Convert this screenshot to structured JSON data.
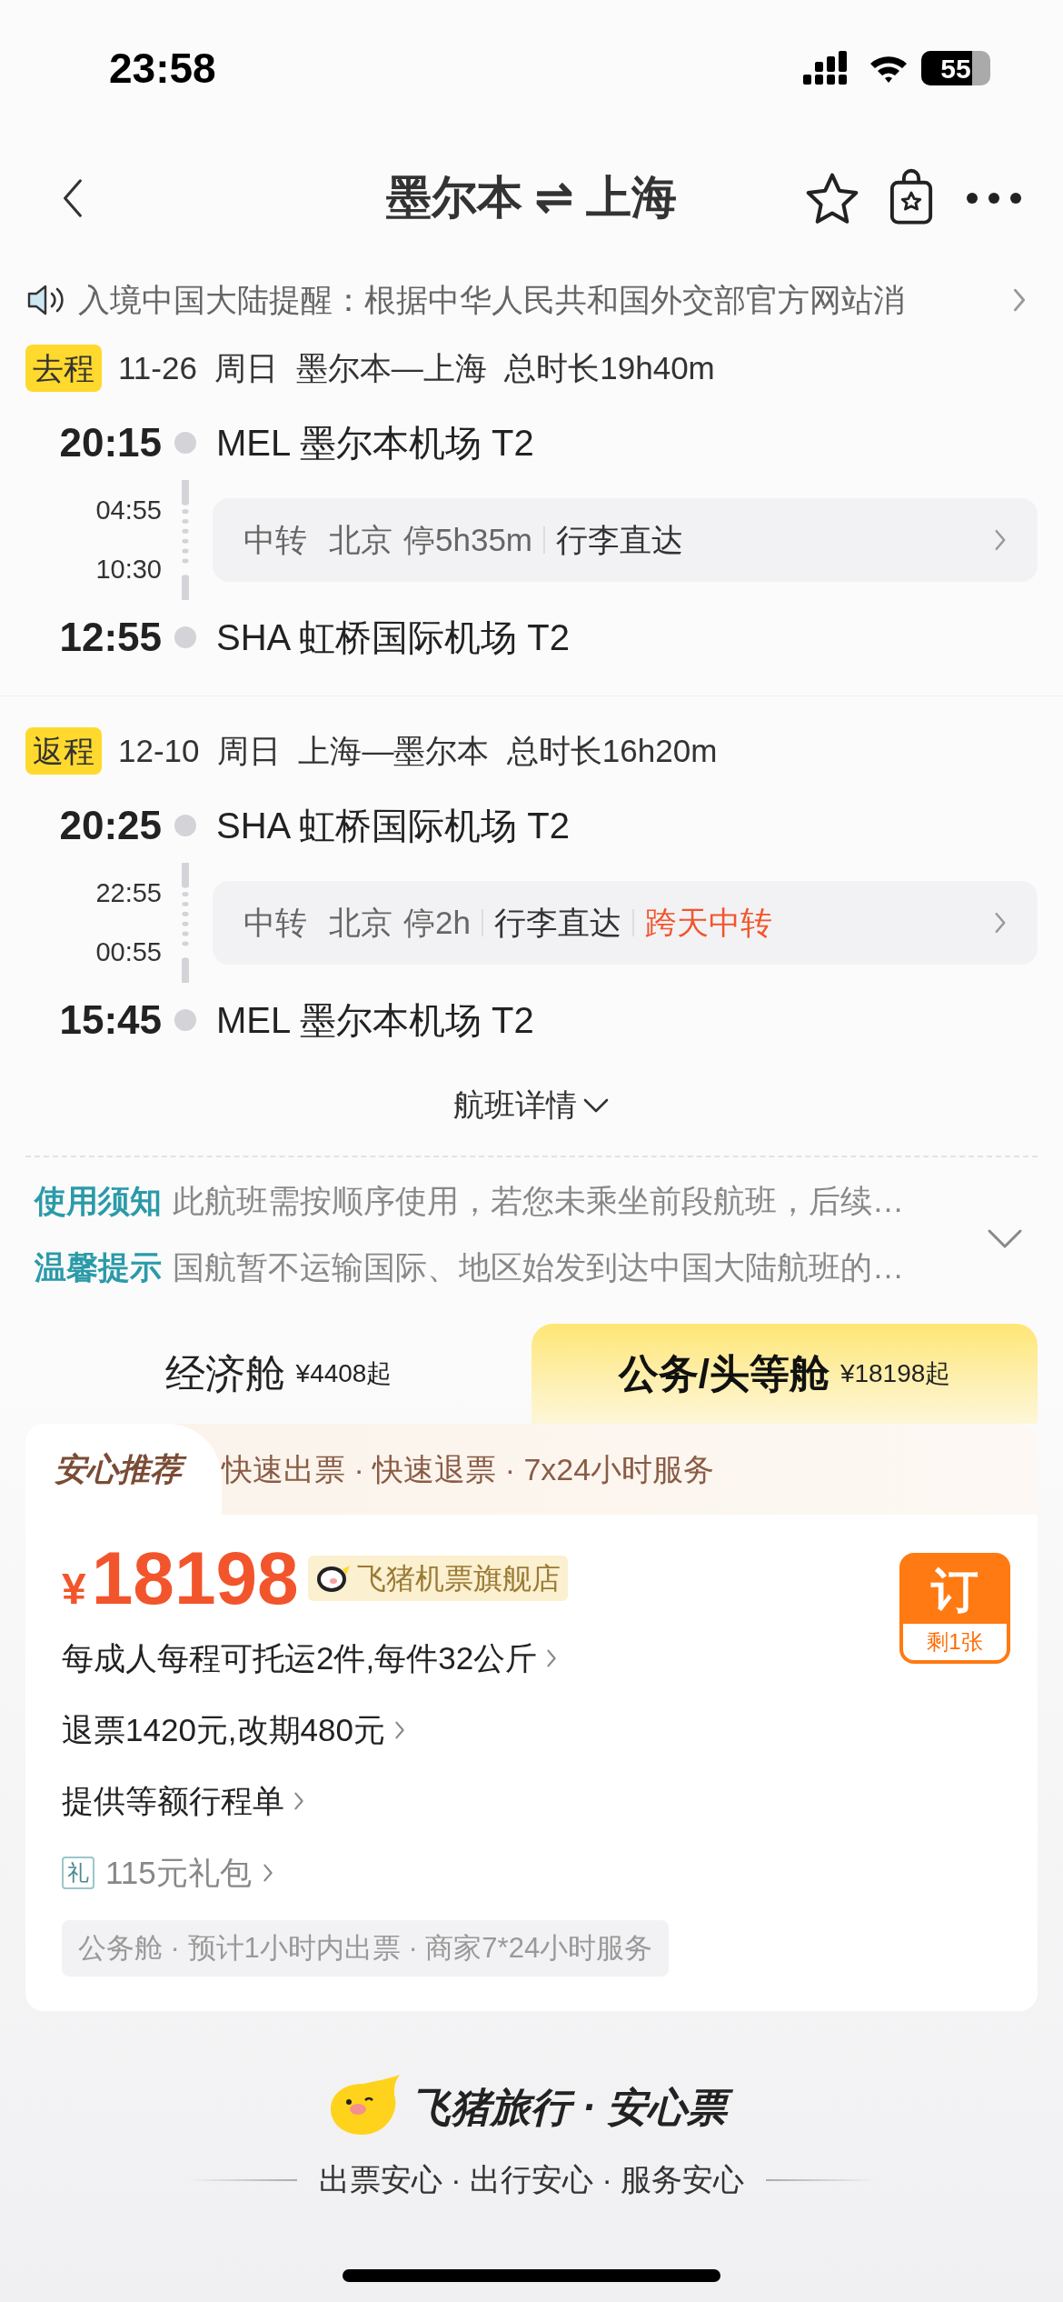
{
  "status_bar": {
    "time": "23:58",
    "battery": "55"
  },
  "nav": {
    "title": "墨尔本 ⇌ 上海"
  },
  "notice": {
    "text": "入境中国大陆提醒：根据中华人民共和国外交部官方网站消"
  },
  "legs": [
    {
      "tag": "去程",
      "date": "11-26",
      "weekday": "周日",
      "route": "墨尔本—上海",
      "duration": "总时长19h40m",
      "departure": {
        "time": "20:15",
        "airport": "MEL 墨尔本机场 T2"
      },
      "layover_times": [
        "04:55",
        "10:30"
      ],
      "transfer": {
        "label": "中转",
        "city": "北京",
        "stop": "停5h35m",
        "tags": [
          {
            "text": "行李直达",
            "kind": "normal"
          }
        ]
      },
      "arrival": {
        "time": "12:55",
        "airport": "SHA 虹桥国际机场 T2"
      }
    },
    {
      "tag": "返程",
      "date": "12-10",
      "weekday": "周日",
      "route": "上海—墨尔本",
      "duration": "总时长16h20m",
      "departure": {
        "time": "20:25",
        "airport": "SHA 虹桥国际机场 T2"
      },
      "layover_times": [
        "22:55",
        "00:55"
      ],
      "transfer": {
        "label": "中转",
        "city": "北京",
        "stop": "停2h",
        "tags": [
          {
            "text": "行李直达",
            "kind": "normal"
          },
          {
            "text": "跨天中转",
            "kind": "alert"
          }
        ]
      },
      "arrival": {
        "time": "15:45",
        "airport": "MEL 墨尔本机场 T2"
      }
    }
  ],
  "details_toggle": "航班详情",
  "notes": [
    {
      "title": "使用须知",
      "text": "此航班需按顺序使用，若您未乘坐前段航班，后续…"
    },
    {
      "title": "温馨提示",
      "text": "国航暂不运输国际、地区始发到达中国大陆航班的…"
    }
  ],
  "cabins": [
    {
      "name": "经济舱",
      "price": "¥4408起",
      "selected": false
    },
    {
      "name": "公务/头等舱",
      "price": "¥18198起",
      "selected": true
    }
  ],
  "offer": {
    "badge": "安心推荐",
    "services": "快速出票 · 快速退票 · 7x24小时服务",
    "currency": "¥",
    "price": "18198",
    "shop": "飞猪机票旗舰店",
    "book": "订",
    "remaining": "剩1张",
    "lines": [
      "每成人每程可托运2件,每件32公斤",
      "退票1420元,改期480元",
      "提供等额行程单"
    ],
    "gift": {
      "icon_text": "礼",
      "text": "115元礼包"
    },
    "summary": "公务舱 · 预计1小时内出票 · 商家7*24小时服务"
  },
  "footer": {
    "brand": "飞猪旅行 · 安心票",
    "slogan": "出票安心 · 出行安心 · 服务安心"
  }
}
